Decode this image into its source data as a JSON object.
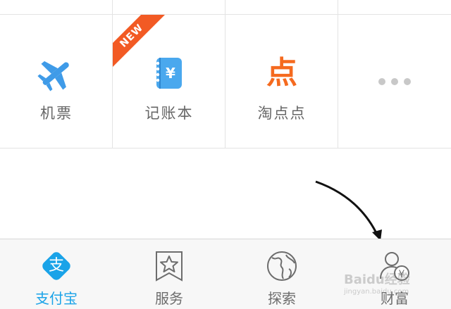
{
  "grid": {
    "items": [
      {
        "label": "机票",
        "icon": "airplane-icon"
      },
      {
        "label": "记账本",
        "icon": "ledger-book-icon",
        "badge": "NEW"
      },
      {
        "label": "淘点点",
        "icon": "taodiandian-logo-icon",
        "logo_text": "点"
      },
      {
        "label": "",
        "icon": "more-dots-icon"
      }
    ]
  },
  "tabbar": {
    "tabs": [
      {
        "label": "支付宝",
        "icon": "alipay-logo-icon",
        "logo_text": "支",
        "active": true
      },
      {
        "label": "服务",
        "icon": "service-star-icon",
        "active": false
      },
      {
        "label": "探索",
        "icon": "globe-icon",
        "active": false
      },
      {
        "label": "财富",
        "icon": "wealth-person-yen-icon",
        "active": false
      }
    ]
  },
  "watermark": {
    "text": "Baidu经验",
    "sub": "jingyan.baidu.com"
  },
  "colors": {
    "accent_blue": "#1aa3e8",
    "plane_blue": "#3f9be8",
    "ledger_blue": "#4aa8ee",
    "tao_orange": "#f56a1f",
    "ribbon_orange": "#f25a24",
    "dots_gray": "#c8c8c8",
    "label_gray": "#666666"
  }
}
